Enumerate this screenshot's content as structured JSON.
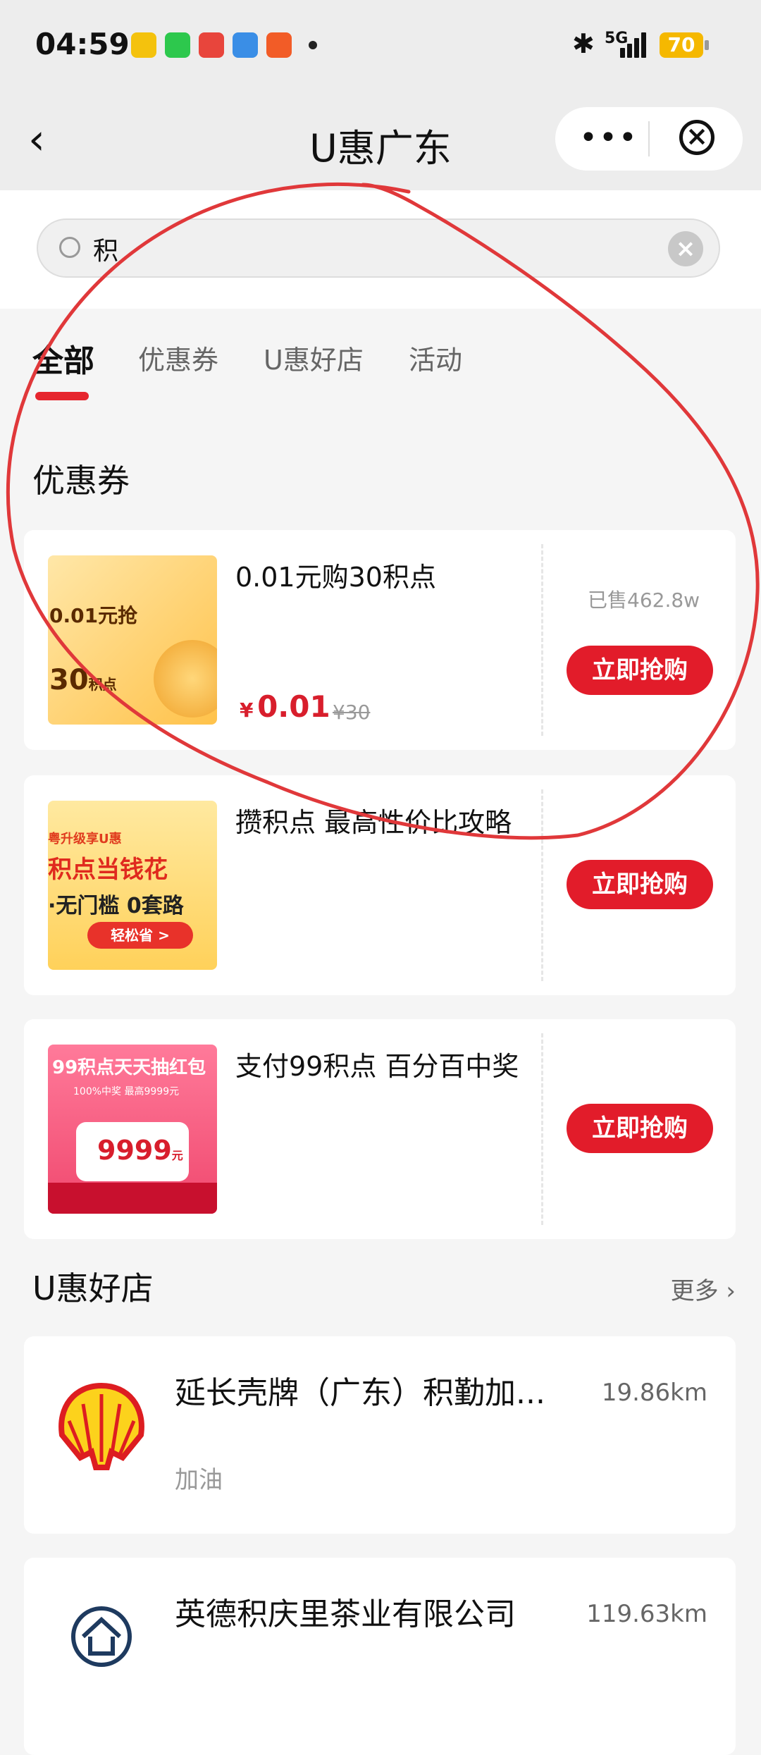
{
  "status_bar": {
    "time": "04:59",
    "network": "5G",
    "battery": "70"
  },
  "nav": {
    "title": "U惠广东",
    "more": "•••"
  },
  "search": {
    "value": "积"
  },
  "tabs": [
    {
      "label": "全部"
    },
    {
      "label": "优惠券"
    },
    {
      "label": "U惠好店"
    },
    {
      "label": "活动"
    }
  ],
  "sections": {
    "coupons_title": "优惠券",
    "stores_title": "U惠好店",
    "more": "更多 ›"
  },
  "coupons": [
    {
      "title": "0.01元购30积点",
      "price_symbol": "¥",
      "price": "0.01",
      "original_price": "¥30",
      "sold": "已售462.8w",
      "button": "立即抢购",
      "thumb_text1": "0.01元抢",
      "thumb_text2": "30",
      "thumb_text3": "积点"
    },
    {
      "title": "攒积点 最高性价比攻略",
      "button": "立即抢购",
      "thumb_text1": "粤升级享U惠",
      "thumb_text2": "积点当钱花",
      "thumb_text3": "·无门槛 0套路",
      "thumb_text4": "轻松省 >"
    },
    {
      "title": "支付99积点 百分百中奖",
      "button": "立即抢购",
      "thumb_text1": "99积点天天抽红包",
      "thumb_text2": "100%中奖 最高9999元",
      "thumb_text3": "9999",
      "thumb_text4": "元"
    }
  ],
  "stores": [
    {
      "name": "延长壳牌（广东）积勤加...",
      "distance": "19.86km",
      "category": "加油"
    },
    {
      "name": "英德积庆里茶业有限公司",
      "distance": "119.63km"
    }
  ],
  "colors": {
    "accent": "#e21c2a",
    "annotation": "#e0383a"
  }
}
